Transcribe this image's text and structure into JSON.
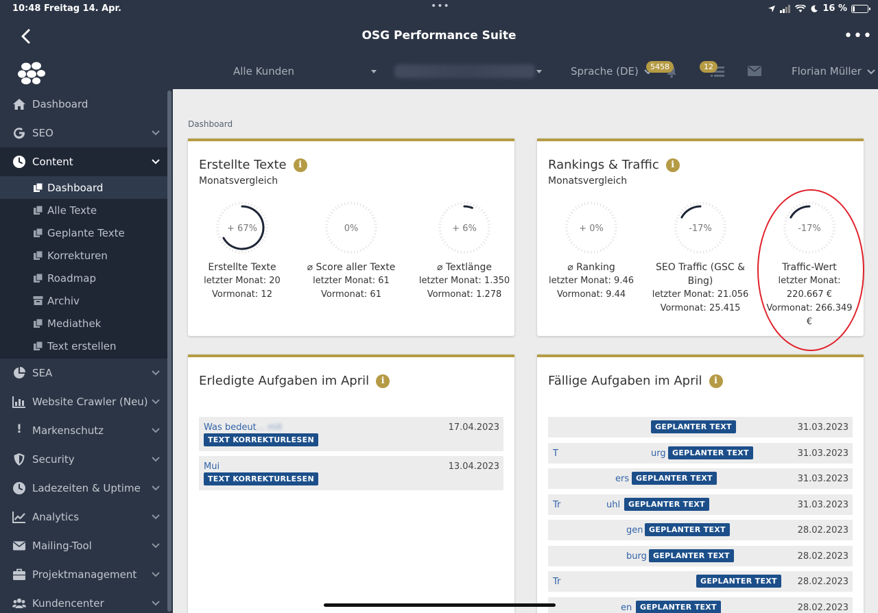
{
  "status_bar": {
    "time": "10:48",
    "date": "Freitag 14. Apr.",
    "battery": "16 %",
    "battery_level": 0.16
  },
  "app": {
    "title": "OSG Performance Suite"
  },
  "topnav": {
    "customers": "Alle Kunden",
    "language": "Sprache (DE)",
    "notifications_count": "5458",
    "tasks_count": "12",
    "user": "Florian Müller"
  },
  "sidebar": {
    "items": [
      {
        "label": "Dashboard",
        "icon": "home-icon"
      },
      {
        "label": "SEO",
        "icon": "google-icon"
      },
      {
        "label": "Content",
        "icon": "clock-icon"
      },
      {
        "label": "SEA",
        "icon": "pie-chart-icon"
      },
      {
        "label": "Website Crawler (Neu)",
        "icon": "bar-chart-icon"
      },
      {
        "label": "Markenschutz",
        "icon": "exclamation-icon"
      },
      {
        "label": "Security",
        "icon": "shield-icon"
      },
      {
        "label": "Ladezeiten & Uptime",
        "icon": "clock-icon"
      },
      {
        "label": "Analytics",
        "icon": "line-chart-icon"
      },
      {
        "label": "Mailing-Tool",
        "icon": "envelope-icon"
      },
      {
        "label": "Projektmanagement",
        "icon": "briefcase-icon"
      },
      {
        "label": "Kundencenter",
        "icon": "users-icon"
      }
    ],
    "content_submenu": [
      "Dashboard",
      "Alle Texte",
      "Geplante Texte",
      "Korrekturen",
      "Roadmap",
      "Archiv",
      "Mediathek",
      "Text erstellen"
    ]
  },
  "main": {
    "breadcrumb": "Dashboard",
    "texts_card": {
      "title": "Erstellte Texte",
      "subtitle": "Monatsvergleich",
      "gauges": [
        {
          "value_label": "+ 67%",
          "percent": 67,
          "name": "Erstellte Texte",
          "lines": [
            "letzter Monat: 20",
            "Vormonat: 12"
          ]
        },
        {
          "value_label": "0%",
          "percent": 0,
          "name": "⌀ Score aller Texte",
          "lines": [
            "letzter Monat: 61",
            "Vormonat: 61"
          ]
        },
        {
          "value_label": "+ 6%",
          "percent": 6,
          "name": "⌀ Textlänge",
          "lines": [
            "letzter Monat: 1.350",
            "Vormonat: 1.278"
          ]
        }
      ]
    },
    "rankings_card": {
      "title": "Rankings & Traffic",
      "subtitle": "Monatsvergleich",
      "gauges": [
        {
          "value_label": "+ 0%",
          "percent": 0,
          "name": "⌀ Ranking",
          "lines": [
            "letzter Monat: 9.46",
            "Vormonat: 9.44"
          ]
        },
        {
          "value_label": "-17%",
          "percent": -17,
          "name": "SEO Traffic (GSC & Bing)",
          "lines": [
            "letzter Monat: 21.056",
            "Vormonat: 25.415"
          ]
        },
        {
          "value_label": "-17%",
          "percent": -17,
          "name": "Traffic-Wert",
          "lines": [
            "letzter Monat:",
            "220.667 €",
            "Vormonat: 266.349",
            "€"
          ]
        }
      ]
    },
    "done_card": {
      "title": "Erledigte Aufgaben im April",
      "tasks": [
        {
          "name": "Was bedeut",
          "name_tail": "... mit",
          "tag": "TEXT KORREKTURLESEN",
          "date": "17.04.2023"
        },
        {
          "name": "Mui",
          "name_tail": "",
          "tag": "TEXT KORREKTURLESEN",
          "date": "13.04.2023"
        }
      ]
    },
    "due_card": {
      "title": "Fällige Aufgaben im April",
      "tasks": [
        {
          "name": "",
          "tail": "",
          "tag": "GEPLANTER TEXT",
          "date": "31.03.2023"
        },
        {
          "name": "T",
          "tail": "urg",
          "tag": "GEPLANTER TEXT",
          "date": "31.03.2023"
        },
        {
          "name": "",
          "tail": "ers",
          "tag": "GEPLANTER TEXT",
          "date": "31.03.2023"
        },
        {
          "name": "Tr",
          "tail": "uhl",
          "tag": "GEPLANTER TEXT",
          "date": "31.03.2023"
        },
        {
          "name": "",
          "tail": "gen",
          "tag": "GEPLANTER TEXT",
          "date": "28.02.2023"
        },
        {
          "name": "",
          "tail": "burg",
          "tag": "GEPLANTER TEXT",
          "date": "28.02.2023"
        },
        {
          "name": "Tr",
          "tail": "",
          "tag": "GEPLANTER TEXT",
          "date": "28.02.2023"
        },
        {
          "name": "",
          "tail": "en",
          "tag": "GEPLANTER TEXT",
          "date": "28.02.2023"
        }
      ]
    }
  },
  "colors": {
    "accent": "#b59b45",
    "tag_blue": "#1c4f8a",
    "link_blue": "#3163a8",
    "sidebar_bg": "#2c3545",
    "sidebar_active": "#1f2735",
    "highlight": "#e0202a"
  }
}
